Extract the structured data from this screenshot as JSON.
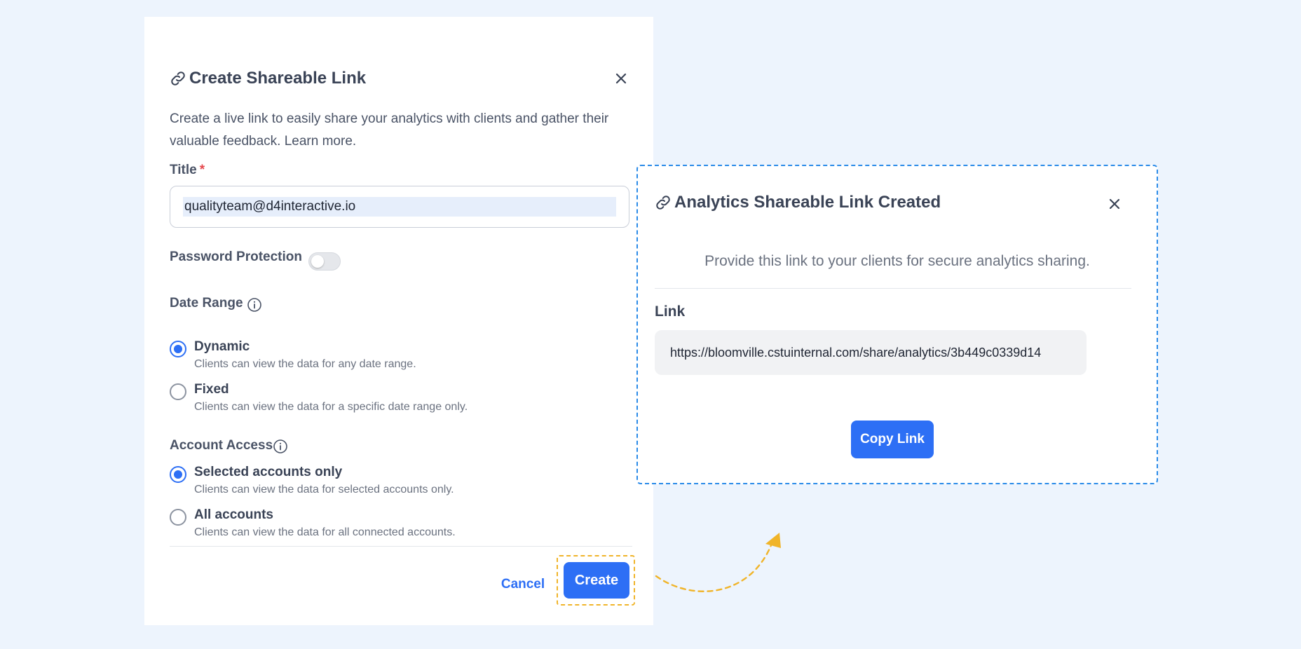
{
  "dialog": {
    "title": "Create Shareable Link",
    "description": "Create a live link to easily share your analytics with clients and gather their valuable feedback. Learn more.",
    "title_field": {
      "label": "Title",
      "required_mark": "*",
      "value": "qualityteam@d4interactive.io"
    },
    "password_protection": {
      "label": "Password Protection",
      "enabled": false
    },
    "date_range": {
      "label": "Date Range",
      "options": [
        {
          "title": "Dynamic",
          "description": "Clients can view the data for any date range.",
          "selected": true
        },
        {
          "title": "Fixed",
          "description": "Clients can view the data for a specific date range only.",
          "selected": false
        }
      ]
    },
    "account_access": {
      "label": "Account Access",
      "options": [
        {
          "title": "Selected accounts only",
          "description": "Clients can view the data for selected accounts only.",
          "selected": true
        },
        {
          "title": "All accounts",
          "description": "Clients can view the data for all connected accounts.",
          "selected": false
        }
      ]
    },
    "cancel_label": "Cancel",
    "create_label": "Create"
  },
  "popup": {
    "title": "Analytics Shareable Link Created",
    "subtitle": "Provide this link to your clients for secure analytics sharing.",
    "link_label": "Link",
    "link_value": "https://bloomville.cstuinternal.com/share/analytics/3b449c0339d14",
    "copy_label": "Copy Link"
  },
  "icons": {
    "link": "link-icon",
    "close": "close-icon",
    "info": "info-icon"
  },
  "colors": {
    "background": "#edf4fd",
    "primary": "#2d6ff5",
    "highlight_outline": "#f0b429",
    "popup_outline": "#2b8be8",
    "required": "#e5484d"
  }
}
